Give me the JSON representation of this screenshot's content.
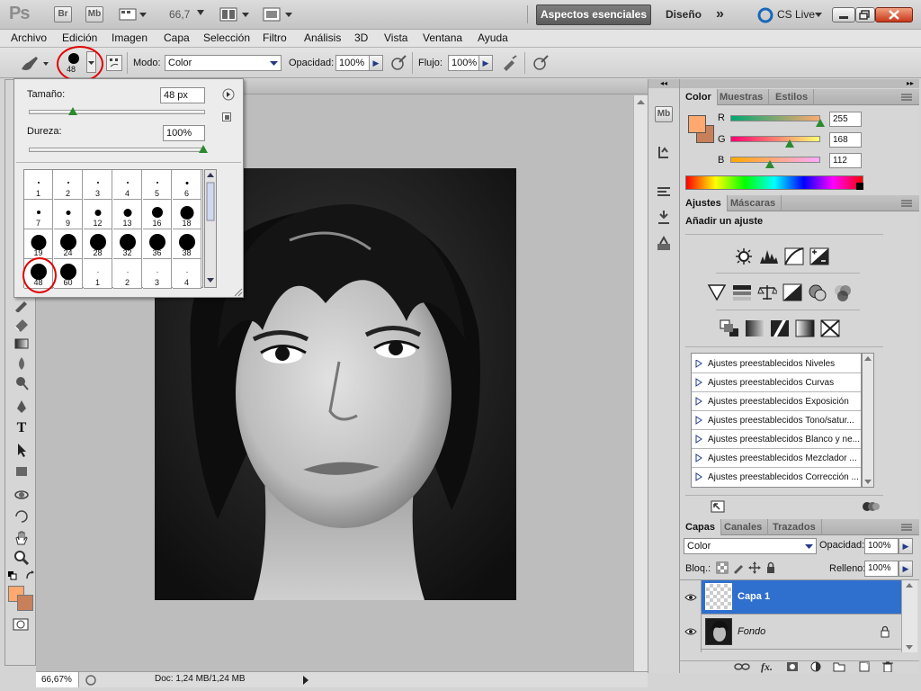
{
  "app": {
    "logo": "Ps",
    "bridge": "Br",
    "minibridge": "Mb",
    "zoom": "66,7",
    "workspace_active": "Aspectos esenciales",
    "workspace_other": "Diseño",
    "more": "»",
    "cslive": "CS Live"
  },
  "menu": [
    "Archivo",
    "Edición",
    "Imagen",
    "Capa",
    "Selección",
    "Filtro",
    "Análisis",
    "3D",
    "Vista",
    "Ventana",
    "Ayuda"
  ],
  "options": {
    "brush_size_value": "48",
    "mode_label": "Modo:",
    "mode_value": "Color",
    "opacity_label": "Opacidad:",
    "opacity_value": "100%",
    "flow_label": "Flujo:",
    "flow_value": "100%"
  },
  "brush_popup": {
    "size_label": "Tamaño:",
    "size_value": "48 px",
    "size_level": 0.25,
    "hardness_label": "Dureza:",
    "hardness_value": "100%",
    "hardness_level": 1.0,
    "presets": [
      {
        "n": "1",
        "d": 2
      },
      {
        "n": "2",
        "d": 2
      },
      {
        "n": "3",
        "d": 2
      },
      {
        "n": "4",
        "d": 2
      },
      {
        "n": "5",
        "d": 2
      },
      {
        "n": "6",
        "d": 3
      },
      {
        "n": "7",
        "d": 4
      },
      {
        "n": "9",
        "d": 5
      },
      {
        "n": "12",
        "d": 7
      },
      {
        "n": "13",
        "d": 9
      },
      {
        "n": "16",
        "d": 12
      },
      {
        "n": "18",
        "d": 15
      },
      {
        "n": "19",
        "d": 17
      },
      {
        "n": "24",
        "d": 18
      },
      {
        "n": "28",
        "d": 18
      },
      {
        "n": "32",
        "d": 18
      },
      {
        "n": "36",
        "d": 18
      },
      {
        "n": "38",
        "d": 18
      },
      {
        "n": "48",
        "d": 18
      },
      {
        "n": "60",
        "d": 18
      },
      {
        "n": "1",
        "d": 1
      },
      {
        "n": "2",
        "d": 1
      },
      {
        "n": "3",
        "d": 1
      },
      {
        "n": "4",
        "d": 1
      }
    ]
  },
  "status": {
    "zoom": "66,67%",
    "doc": "Doc: 1,24 MB/1,24 MB"
  },
  "color_panel": {
    "tabs": [
      "Color",
      "Muestras",
      "Estilos"
    ],
    "r_label": "R",
    "g_label": "G",
    "b_label": "B",
    "r": "255",
    "g": "168",
    "b": "112",
    "foreground": "#ffa870",
    "background": "#c8805a"
  },
  "adjust_panel": {
    "tabs": [
      "Ajustes",
      "Máscaras"
    ],
    "title": "Añadir un ajuste",
    "presets": [
      "Ajustes preestablecidos Niveles",
      "Ajustes preestablecidos Curvas",
      "Ajustes preestablecidos Exposición",
      "Ajustes preestablecidos Tono/satur...",
      "Ajustes preestablecidos Blanco y ne...",
      "Ajustes preestablecidos Mezclador ...",
      "Ajustes preestablecidos Corrección ..."
    ]
  },
  "layers_panel": {
    "tabs": [
      "Capas",
      "Canales",
      "Trazados"
    ],
    "blend_mode": "Color",
    "opacity_label": "Opacidad:",
    "opacity_value": "100%",
    "lock_label": "Bloq.:",
    "fill_label": "Relleno:",
    "fill_value": "100%",
    "layers": [
      {
        "name": "Capa 1",
        "selected": true
      },
      {
        "name": "Fondo",
        "selected": false
      }
    ]
  }
}
